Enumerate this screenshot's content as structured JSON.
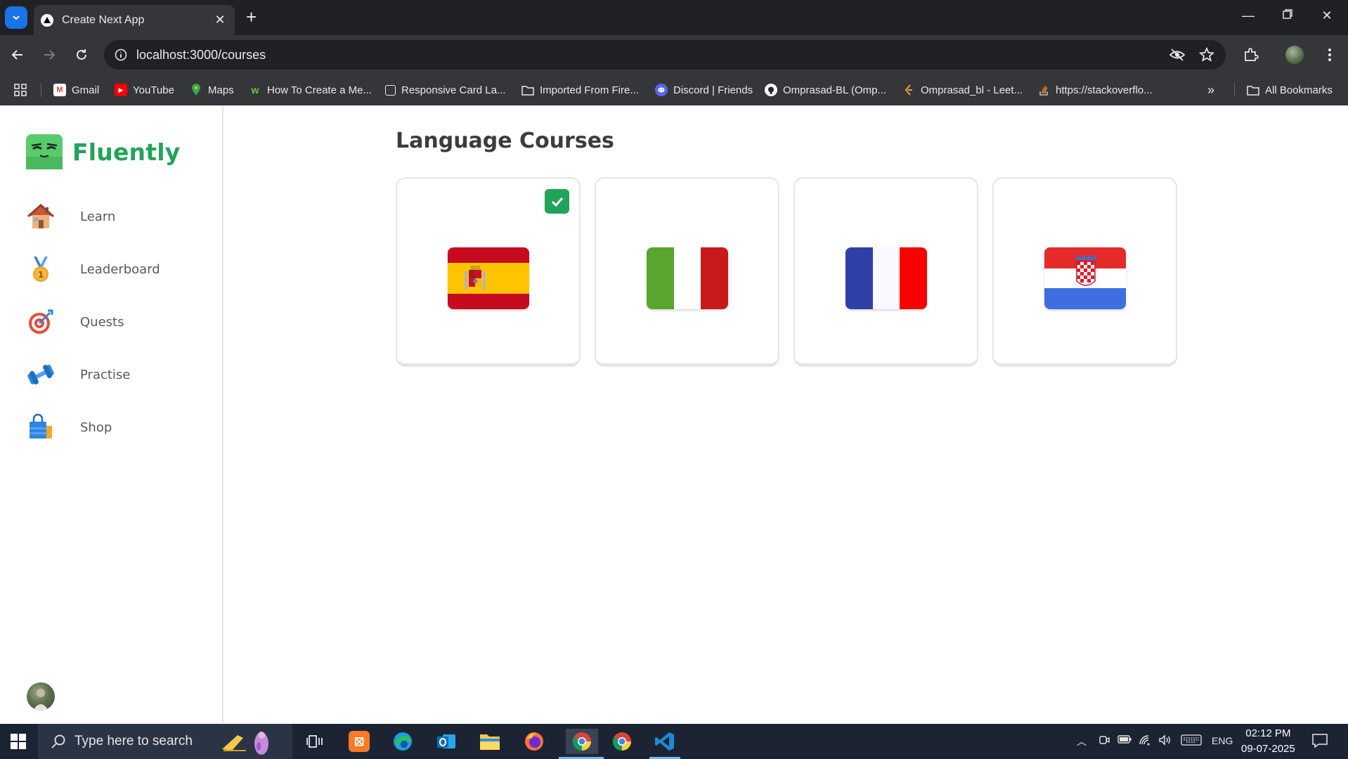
{
  "browser": {
    "tab_title": "Create Next App",
    "url": "localhost:3000/courses",
    "bookmarks": [
      {
        "label": "Gmail",
        "icon": "gmail-icon"
      },
      {
        "label": "YouTube",
        "icon": "youtube-icon"
      },
      {
        "label": "Maps",
        "icon": "maps-icon"
      },
      {
        "label": "How To Create a Me...",
        "icon": "webflow-icon"
      },
      {
        "label": "Responsive Card La...",
        "icon": "page-icon"
      },
      {
        "label": "Imported From Fire...",
        "icon": "folder-icon"
      },
      {
        "label": "Discord | Friends",
        "icon": "discord-icon"
      },
      {
        "label": "Omprasad-BL (Omp...",
        "icon": "github-icon"
      },
      {
        "label": "Omprasad_bl - Leet...",
        "icon": "leetcode-icon"
      },
      {
        "label": "https://stackoverflo...",
        "icon": "stackoverflow-icon"
      }
    ],
    "all_bookmarks": "All Bookmarks"
  },
  "app": {
    "brand": "Fluently",
    "nav": [
      {
        "label": "Learn",
        "icon": "house-icon"
      },
      {
        "label": "Leaderboard",
        "icon": "medal-icon"
      },
      {
        "label": "Quests",
        "icon": "target-icon"
      },
      {
        "label": "Practise",
        "icon": "dumbbell-icon"
      },
      {
        "label": "Shop",
        "icon": "shopping-bag-icon"
      }
    ],
    "page_title": "Language Courses",
    "courses": [
      {
        "flag": "spain-flag-icon",
        "active": true
      },
      {
        "flag": "italy-flag-icon",
        "active": false
      },
      {
        "flag": "france-flag-icon",
        "active": false
      },
      {
        "flag": "croatia-flag-icon",
        "active": false
      }
    ]
  },
  "colors": {
    "brand_green": "#22a35a",
    "check_green": "#22a35a"
  },
  "taskbar": {
    "search_placeholder": "Type here to search",
    "language": "ENG",
    "time": "02:12 PM",
    "date": "09-07-2025"
  }
}
